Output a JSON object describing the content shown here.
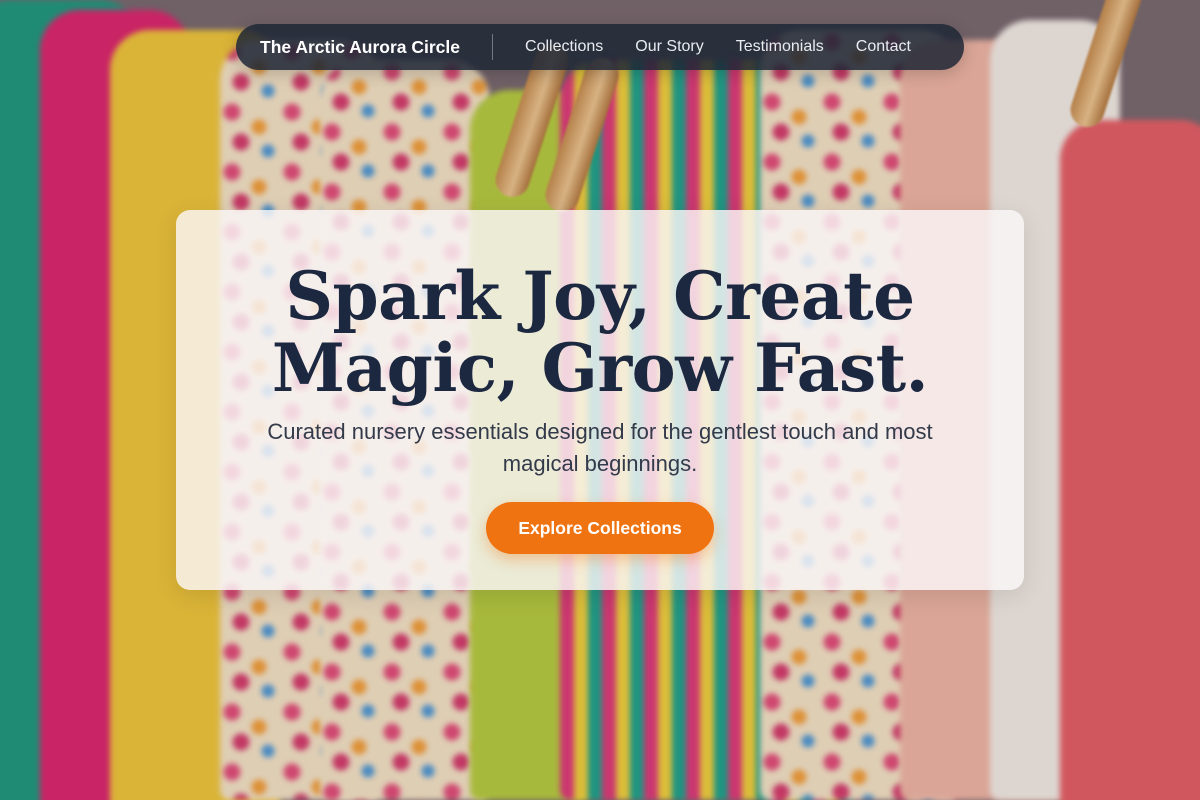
{
  "nav": {
    "brand": "The Arctic Aurora Circle",
    "links": [
      "Collections",
      "Our Story",
      "Testimonials",
      "Contact"
    ]
  },
  "hero": {
    "headline_line1": "Spark Joy, Create",
    "headline_line2": "Magic, Grow Fast.",
    "subtitle": "Curated nursery essentials designed for the gentlest touch and most magical beginnings.",
    "cta_label": "Explore Collections"
  },
  "colors": {
    "nav_background": "#1e2636",
    "headline": "#1c2740",
    "cta": "#f07312"
  }
}
